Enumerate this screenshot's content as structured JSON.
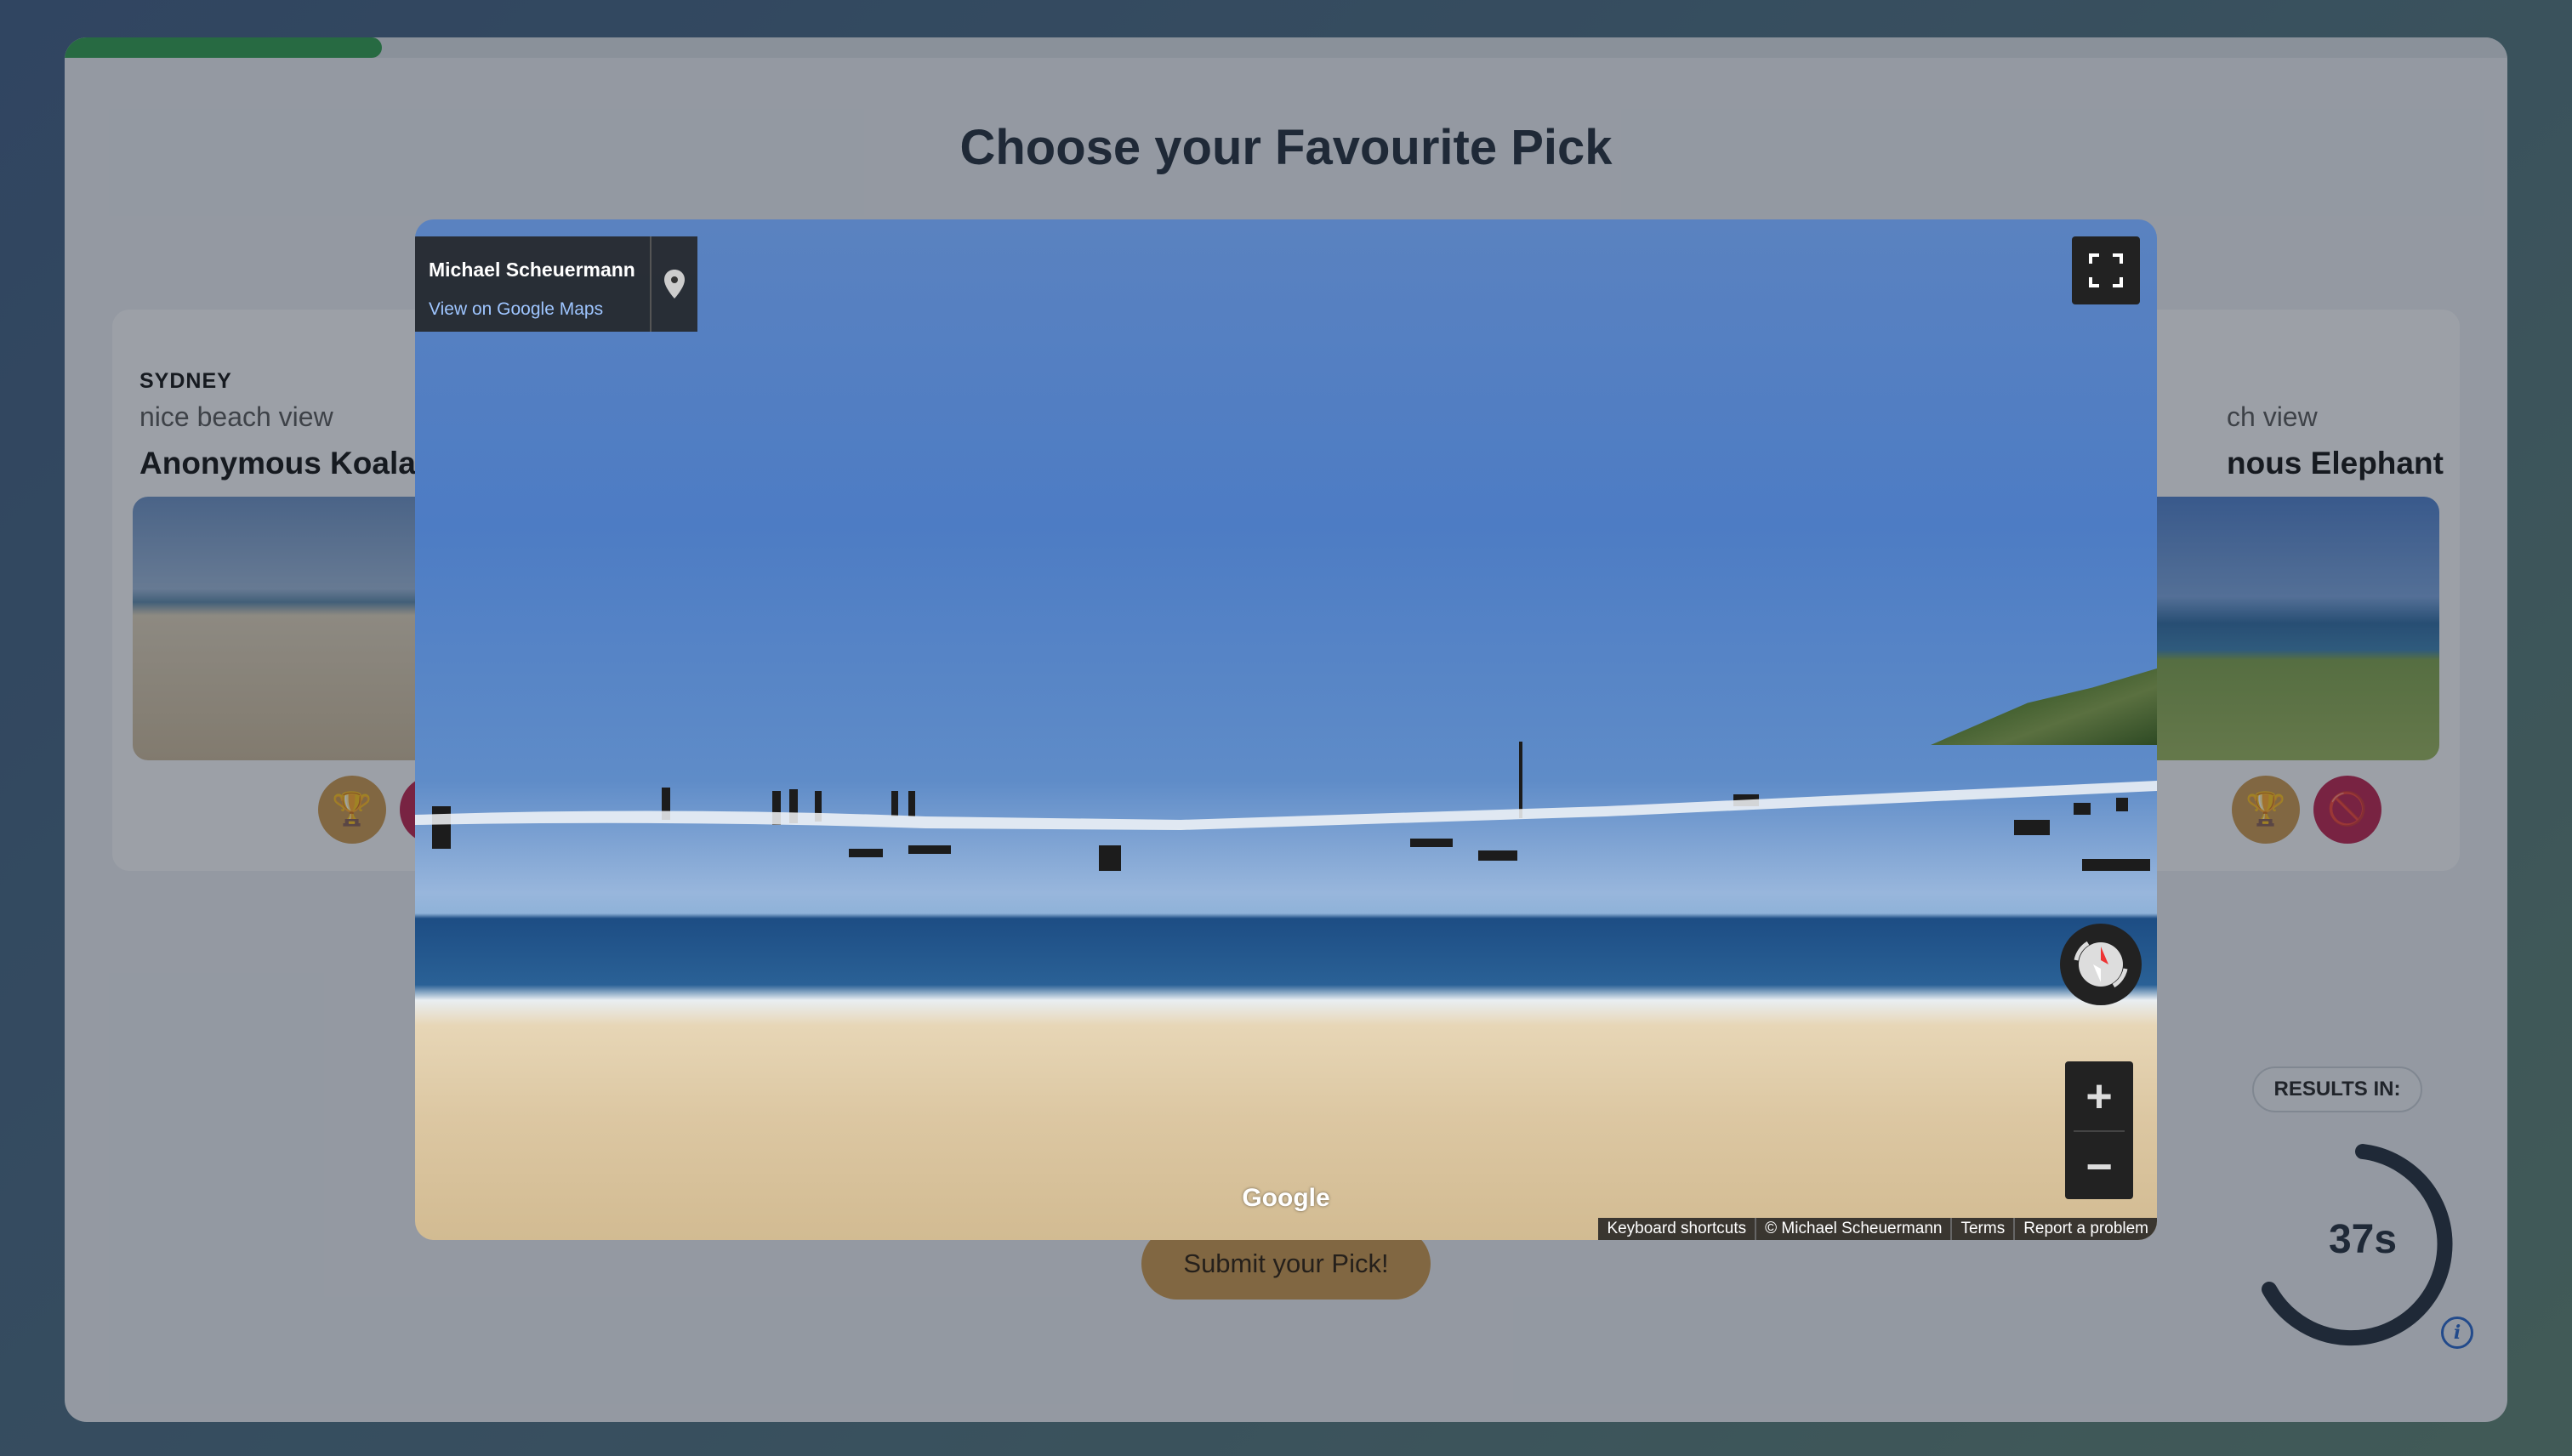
{
  "page": {
    "title": "Choose your Favourite Pick",
    "progress_fraction": 0.13
  },
  "left_card": {
    "city": "SYDNEY",
    "caption": "nice beach view",
    "author": "Anonymous Koala"
  },
  "right_card": {
    "caption": "ch view",
    "author": "nous Elephant"
  },
  "actions": {
    "submit_label": "Submit your Pick!"
  },
  "results": {
    "label": "RESULTS IN:",
    "countdown": "37s"
  },
  "street_view": {
    "photographer": "Michael Scheuermann",
    "view_link": "View on Google Maps",
    "logo_text": "Google",
    "attribution": [
      "Keyboard shortcuts",
      "© Michael Scheuermann",
      "Terms",
      "Report a problem"
    ]
  },
  "colors": {
    "progress": "#2e9a4a",
    "trophy_button": "#c8944a",
    "ban_button": "#b8204a",
    "info_icon": "#2563c9"
  },
  "icons": [
    "trophy-icon",
    "ban-icon",
    "map-pin-icon",
    "fullscreen-icon",
    "compass-icon",
    "zoom-in-icon",
    "zoom-out-icon",
    "info-icon"
  ]
}
